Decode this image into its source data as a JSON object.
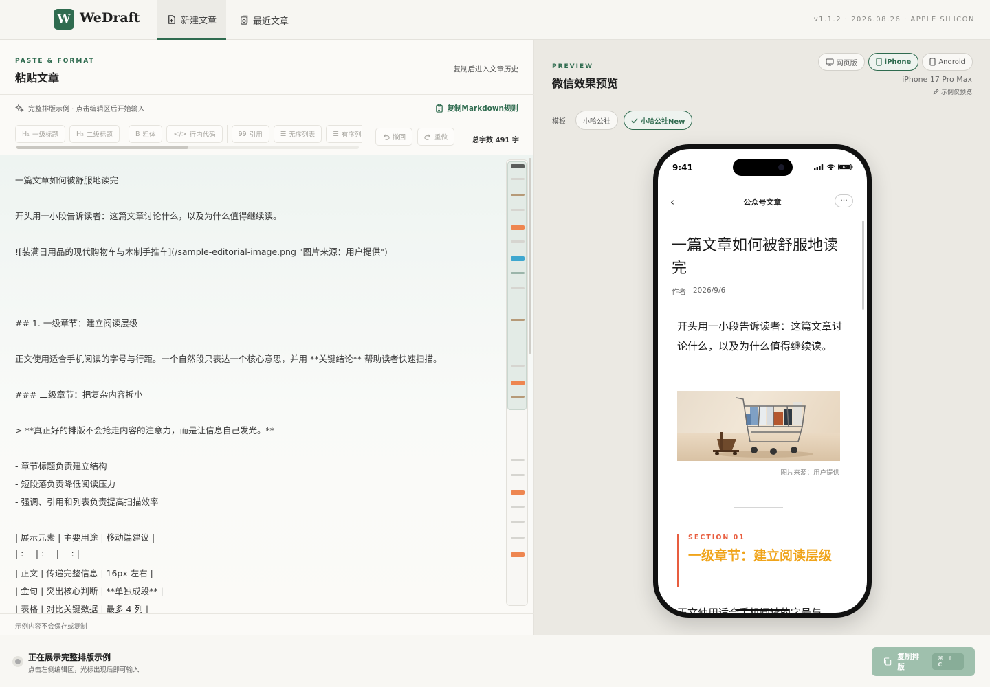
{
  "app": {
    "name": "WeDraft",
    "logo_letter": "W",
    "version": "v1.1.2 · 2026.08.26 · APPLE SILICON",
    "brand_color": "#2f6b4f"
  },
  "nav": {
    "tabs": [
      {
        "label": "新建文章",
        "icon": "new-file-icon",
        "active": true
      },
      {
        "label": "最近文章",
        "icon": "history-icon",
        "active": false
      }
    ]
  },
  "editor_panel": {
    "eyebrow": "PASTE & FORMAT",
    "title": "粘贴文章",
    "history_link": "复制后进入文章历史",
    "hint": "完整排版示例 · 点击编辑区后开始输入",
    "copy_markdown_rules": "复制Markdown规则",
    "toolbar": [
      {
        "label": "一级标题",
        "prefix": "H₁"
      },
      {
        "label": "二级标题",
        "prefix": "H₂"
      },
      {
        "label": "粗体",
        "prefix": "B"
      },
      {
        "label": "行内代码",
        "prefix": "</>"
      },
      {
        "label": "引用",
        "prefix": "99"
      },
      {
        "label": "无序列表",
        "prefix": "☰"
      },
      {
        "label": "有序列表",
        "prefix": "☰"
      }
    ],
    "undo_label": "撤回",
    "redo_label": "重做",
    "word_count": "总字数 491 字",
    "lines": [
      "一篇文章如何被舒服地读完",
      "开头用一小段告诉读者：这篇文章讨论什么，以及为什么值得继续读。",
      "![装满日用品的现代购物车与木制手推车](/sample-editorial-image.png \"图片来源：用户提供\")",
      "---",
      "## 1. 一级章节：建立阅读层级",
      "正文使用适合手机阅读的字号与行距。一个自然段只表达一个核心意思，并用 **关键结论** 帮助读者快速扫描。",
      "### 二级章节：把复杂内容拆小",
      "> **真正好的排版不会抢走内容的注意力，而是让信息自己发光。**",
      "- 章节标题负责建立结构",
      "- 短段落负责降低阅读压力",
      "- 强调、引用和列表负责提高扫描效率",
      "| 展示元素 | 主要用途 | 移动端建议 |",
      "| :--- | :--- | ---: |",
      "| 正文 | 传递完整信息 | 16px 左右 |",
      "| 金句 | 突出核心判断 | **单独成段** |",
      "| 表格 | 对比关键数据 | 最多 4 列 |"
    ],
    "footer_note": "示例内容不会保存或复制"
  },
  "preview_panel": {
    "eyebrow": "PREVIEW",
    "title": "微信效果预览",
    "devices": [
      {
        "label": "网页版",
        "icon": "monitor-icon",
        "active": false
      },
      {
        "label": "iPhone",
        "icon": "phone-icon",
        "active": true
      },
      {
        "label": "Android",
        "icon": "phone-icon",
        "active": false
      }
    ],
    "device_name": "iPhone 17 Pro Max",
    "device_note": "示例仅预览",
    "template_label": "模板",
    "templates": [
      {
        "label": "小哈公社",
        "active": false
      },
      {
        "label": "小哈公社New",
        "active": true
      }
    ],
    "phone": {
      "time": "9:41",
      "battery": "87",
      "nav_title": "公众号文章",
      "article_title": "一篇文章如何被舒服地读完",
      "author_label": "作者",
      "date": "2026/9/6",
      "lead": "开头用一小段告诉读者：这篇文章讨论什么，以及为什么值得继续读。",
      "image_caption": "图片来源：用户提供",
      "section_eyebrow": "SECTION 01",
      "section_title": "一级章节：建立阅读层级",
      "body_start": "正文使用适合手机阅读的字号与",
      "accent_red": "#e85d3f",
      "accent_gold": "#f0a41a"
    }
  },
  "bottom_bar": {
    "status_title": "正在展示完整排版示例",
    "status_sub": "点击左侧编辑区，光标出现后即可输入",
    "copy_button": "复制排版",
    "shortcut": "⌘ ⇧ C"
  }
}
